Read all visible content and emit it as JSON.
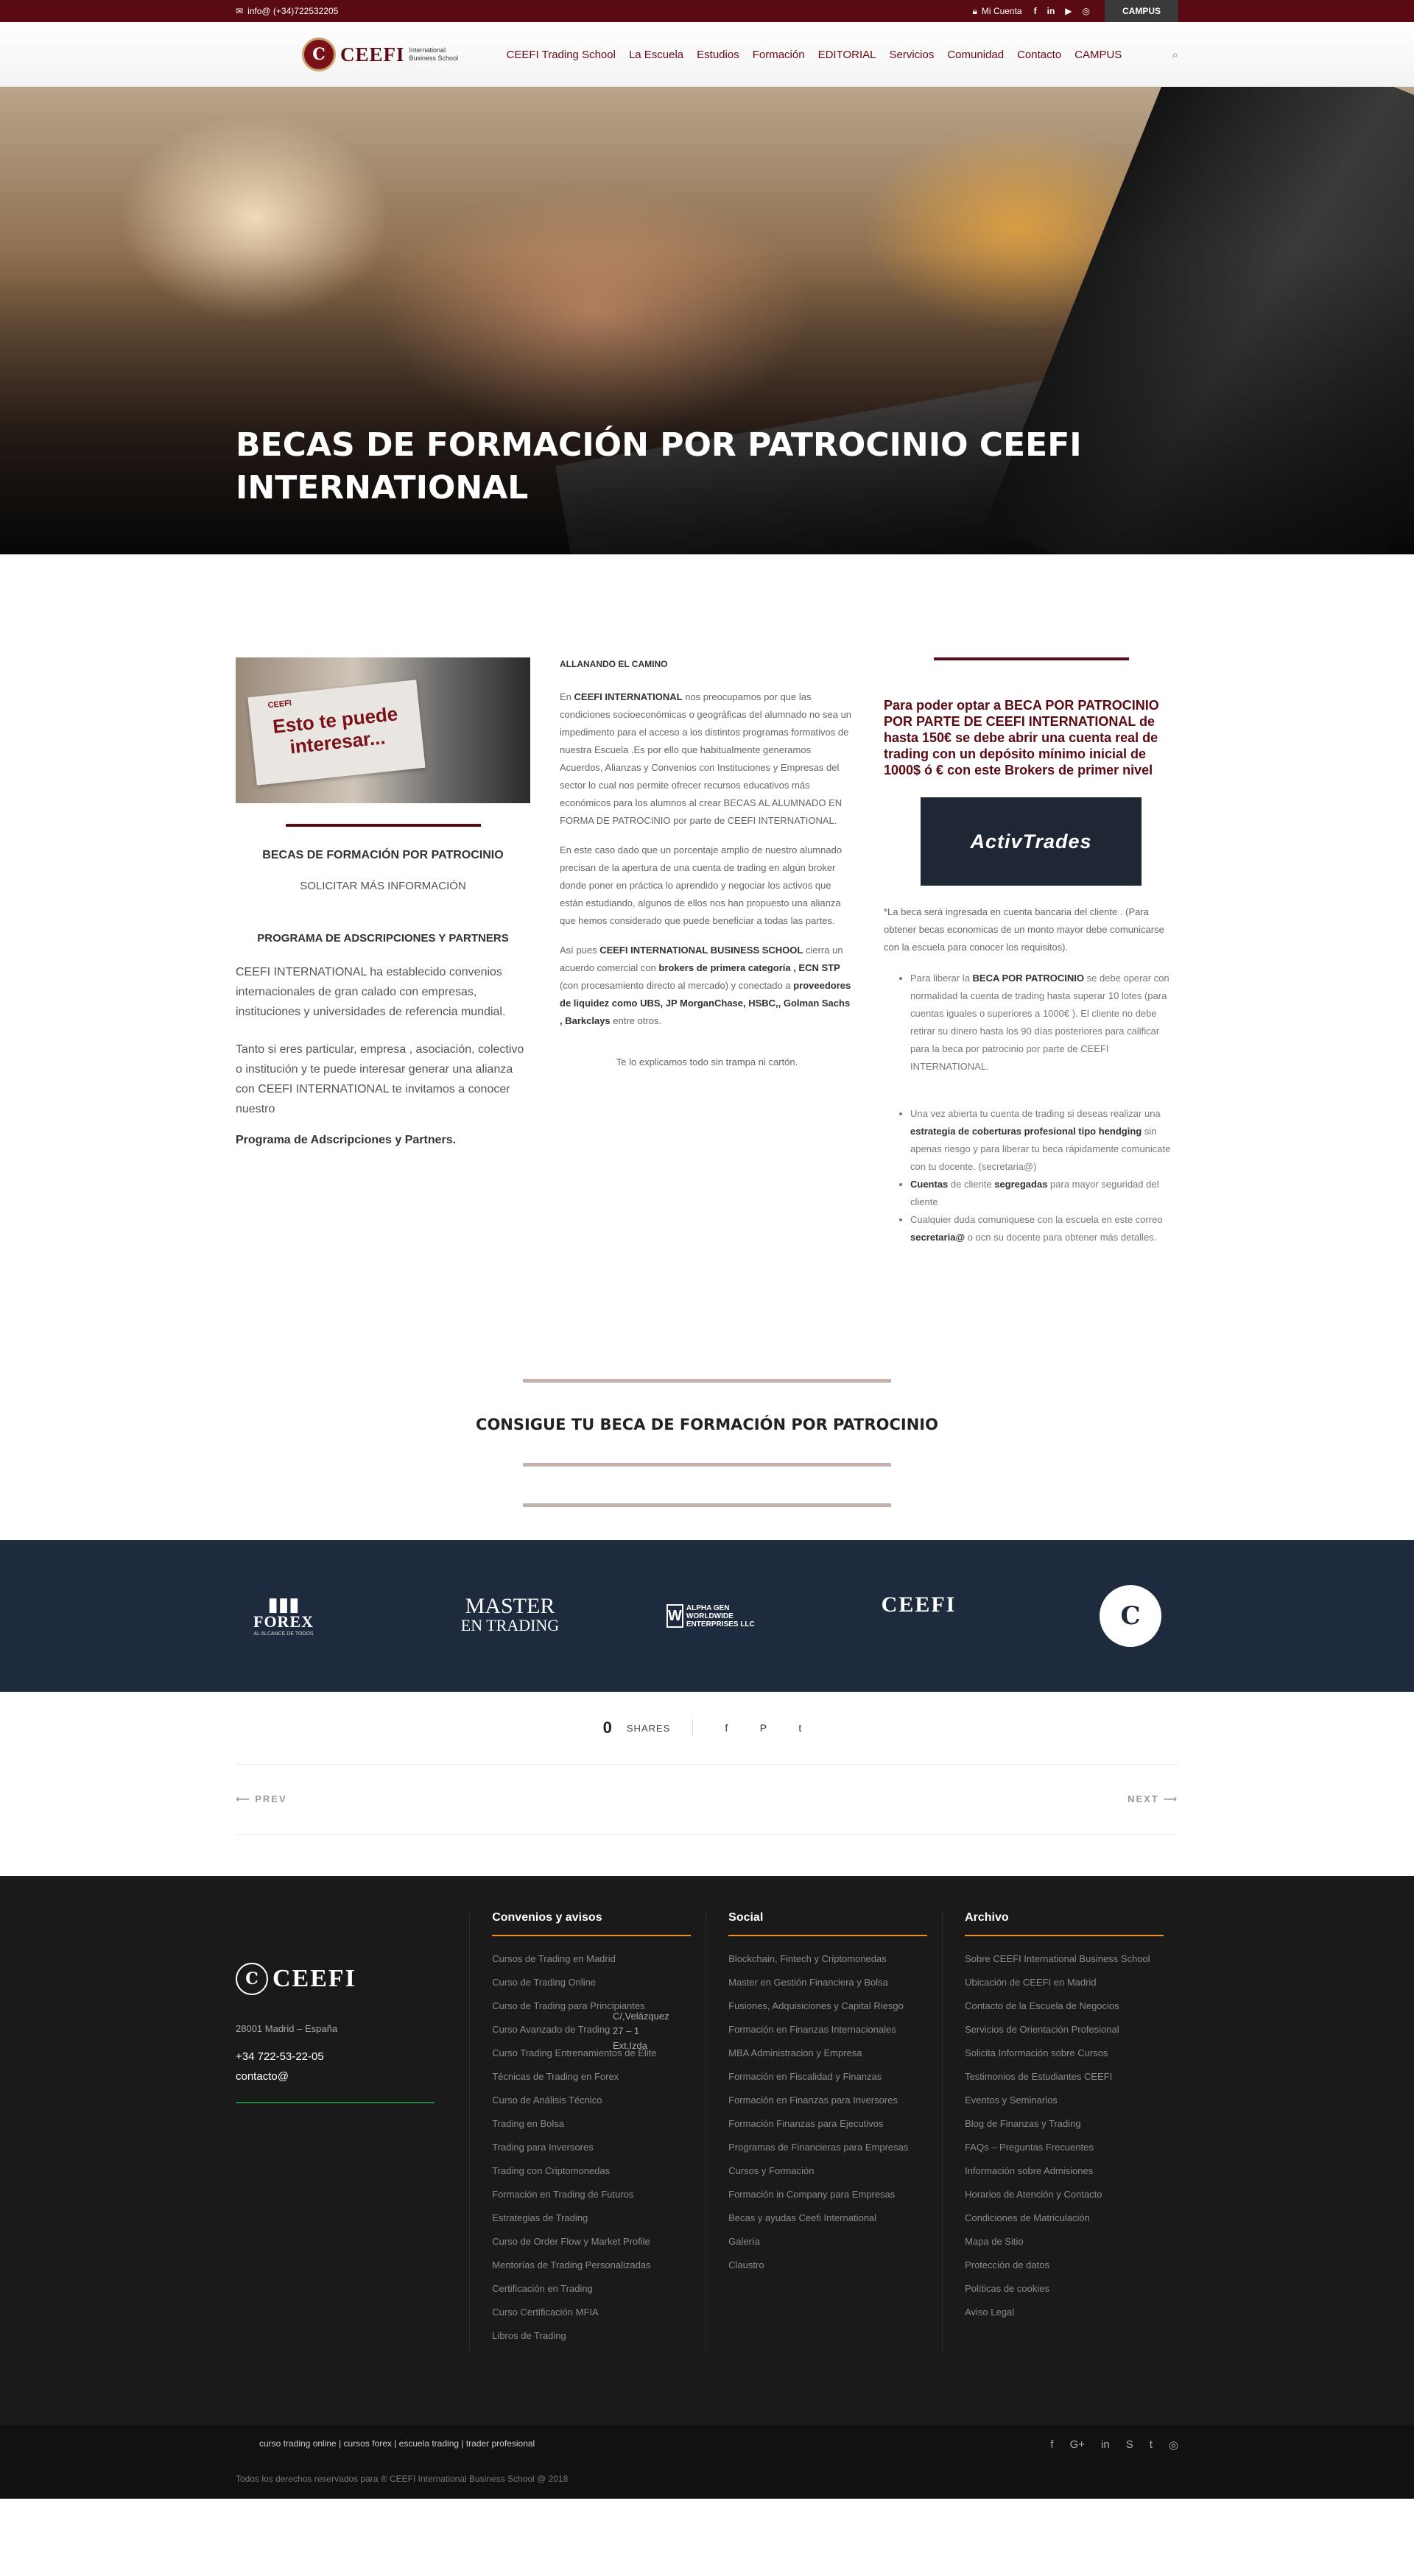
{
  "topbar": {
    "email": "info@ (+34)722532205",
    "account": "Mi Cuenta",
    "social": [
      "f",
      "in",
      "▶",
      "◎"
    ],
    "campus": "CAMPUS"
  },
  "header": {
    "brand": "CEEFI",
    "brand_sub": "International Business School",
    "nav": [
      "CEEFI Trading School",
      "La Escuela",
      "Estudios",
      "Formación",
      "EDITORIAL",
      "Servicios",
      "Comunidad",
      "Contacto",
      "CAMPUS"
    ]
  },
  "hero": {
    "title": "BECAS DE FORMACIÓN POR PATROCINIO CEEFI INTERNATIONAL"
  },
  "col1": {
    "promo_small": "CEEFI",
    "promo_text": "Esto te puede interesar...",
    "title": "BECAS DE FORMACIÓN POR PATROCINIO",
    "link": "SOLICITAR MÁS INFORMACIÓN",
    "heading": "PROGRAMA DE ADSCRIPCIONES Y PARTNERS",
    "p1": "CEEFI INTERNATIONAL   ha establecido convenios internacionales de gran calado con empresas, instituciones y universidades de referencia mundial.",
    "p2": "Tanto si eres particular,  empresa , asociación, colectivo o institución y te puede interesar generar una alianza con CEEFI INTERNATIONAL  te invitamos a conocer nuestro",
    "strong": "Programa de Adscripciones y Partners."
  },
  "col2": {
    "heading": "ALLANANDO EL CAMINO",
    "p1_a": "En ",
    "p1_b": "CEEFI INTERNATIONAL",
    "p1_c": "  nos preocupamos por que  las condiciones socioeconómicas o geográficas del alumnado  no sea un impedimento  para el acceso a los distintos programas formativos de nuestra Escuela .Es por ello que  habitualmente generamos Acuerdos, Alianzas y Convenios con Instituciones y Empresas del sector  lo cual nos permite ofrecer  recursos  educativos más económicos para los alumnos al crear   BECAS AL ALUMNADO EN FORMA DE PATROCINIO por parte de CEEFI INTERNATIONAL.",
    "p2": "En este caso dado que un porcentaje amplio de nuestro alumnado  precisan de la apertura de una cuenta de trading en algún broker donde poner en práctica lo aprendido y negociar los activos que están estudiando, algunos de ellos  nos han propuesto una alianza que hemos considerado que puede beneficiar a todas las partes.",
    "p3_a": "Así pues ",
    "p3_b": "CEEFI INTERNATIONAL BUSINESS SCHOOL",
    "p3_c": " cierra un acuerdo comercial con   ",
    "p3_d": "brokers de primera categoría , ECN  STP",
    "p3_e": " (con procesamiento directo al mercado) y conectado a  ",
    "p3_f": "proveedores de liquidez como UBS, JP MorganChase, HSBC,, Golman Sachs , Barkclays",
    "p3_g": " entre otros.",
    "closing": "Te lo explicamos todo sin trampa ni cartón."
  },
  "col3": {
    "red": "Para poder optar a  BECA POR PATROCINIO POR PARTE DE CEEFI INTERNATIONAL  de hasta 150€  se debe abrir una cuenta real de trading con un depósito mínimo inicial de 1000$ ó € con este Brokers de primer nivel",
    "broker": "ActivTrades",
    "note": "*La beca será ingresada en cuenta bancaria del cliente . (Para  obtener becas economicas   de un monto mayor debe comunicarse con la escuela para conocer  los requisitos).",
    "li1_a": "Para liberar la ",
    "li1_b": "BECA POR PATROCINIO",
    "li1_c": "  se debe operar con normalidad la cuenta de trading   hasta superar  10 lotes (para cuentas iguales o superiores a 1000€ ). El cliente no debe retirar su dinero hasta los 90 días  posteriores para calificar para la beca por patrocinio por parte de CEEFI INTERNATIONAL.",
    "li2_a": "Una vez abierta tu cuenta de trading si deseas realizar una ",
    "li2_b": "estrategia de coberturas profesional tipo hendging",
    "li2_c": " sin apenas riesgo y  para liberar tu beca rápidamente  comunicate con tu docente. (secretaria@)",
    "li3_a": "Cuentas",
    "li3_b": " de cliente ",
    "li3_c": "segregadas",
    "li3_d": " para mayor seguridad del cliente",
    "li4_a": "Cualquier duda  comuniquese  con la escuela en este correo ",
    "li4_b": "secretaria@",
    "li4_c": "  o ocn su docente para obtener más detalles."
  },
  "cta": {
    "title": "CONSIGUE TU BECA DE FORMACIÓN POR PATROCINIO"
  },
  "partners": {
    "forex": "FOREX",
    "forex_sub": "AL ALCANCE DE TODOS",
    "master": "MASTER",
    "master_sub": "EN TRADING",
    "alpha_w": "W",
    "alpha": "ALPHA GEN WORLDWIDE ENTERPRISES LLC",
    "ceefi": "CEEFI",
    "seal": "C"
  },
  "share": {
    "count": "0",
    "label": "SHARES",
    "icons": [
      "f",
      "P",
      "t"
    ]
  },
  "pagenav": {
    "prev": "PREV",
    "next": "NEXT"
  },
  "footer": {
    "brand": "CEEFI",
    "address": "C/,Velázquez 27 – 1 Ext.Izda",
    "city": "28001 Madrid – España",
    "phone": "+34 722-53-22-05",
    "email": "contacto@",
    "col1_title": "Convenios y avisos",
    "col1": [
      "Cursos de Trading en Madrid",
      "Curso de Trading Online",
      "Curso de Trading para Principiantes",
      "Curso Avanzado de Trading",
      "Curso Trading Entrenamientos de Elite",
      "Técnicas de Trading en Forex",
      "Curso de Análisis Técnico",
      "Trading en Bolsa",
      "Trading para Inversores",
      "Trading con Criptomonedas",
      "Formación en Trading de Futuros",
      "Estrategias de Trading",
      "Curso de Order Flow y Market Profile",
      "Mentorías de Trading Personalizadas",
      "Certificación en Trading",
      "Curso Certificación MFIA",
      "Libros de Trading"
    ],
    "col2_title": "Social",
    "col2": [
      "Blockchain, Fintech y Criptomonedas",
      "Master en Gestión Financiera y Bolsa",
      "Fusiones, Adquisiciones y Capital Riesgo",
      "Formación en Finanzas Internacionales",
      "MBA Administracion y Empresa",
      "Formación en Fiscalidad y Finanzas",
      "Formación en Finanzas para Inversores",
      "Formación Finanzas para Ejecutivos",
      "Programas de Financieras para Empresas",
      "Cursos y Formación",
      "Formación in Company para Empresas",
      "Becas y ayudas Ceefi International",
      "Galería",
      "Claustro"
    ],
    "col3_title": "Archivo",
    "col3": [
      "Sobre CEEFI International Business School",
      "Ubicación de CEEFI en Madrid",
      "Contacto de la Escuela de Negocios",
      "Servicios de Orientación Profesional",
      "Solicita Información sobre Cursos",
      "Testimonios de Estudiantes CEEFI",
      "Eventos y Seminarios",
      "Blog de Finanzas y Trading",
      "FAQs – Preguntas Frecuentes",
      "Información sobre Admisiones",
      "Horarios de Atención y Contacto",
      "Condiciones de Matriculación",
      "Mapa de Sitio",
      "Protección de datos",
      "Políticas de cookies",
      "Aviso Legal"
    ],
    "bottom_links": "curso trading online | cursos forex | escuela trading | trader profesional",
    "copyright": "Todos los derechos reservados para ® CEEFI International Business School @ 2018",
    "social": [
      "f",
      "G+",
      "in",
      "S",
      "t",
      "◎"
    ]
  }
}
